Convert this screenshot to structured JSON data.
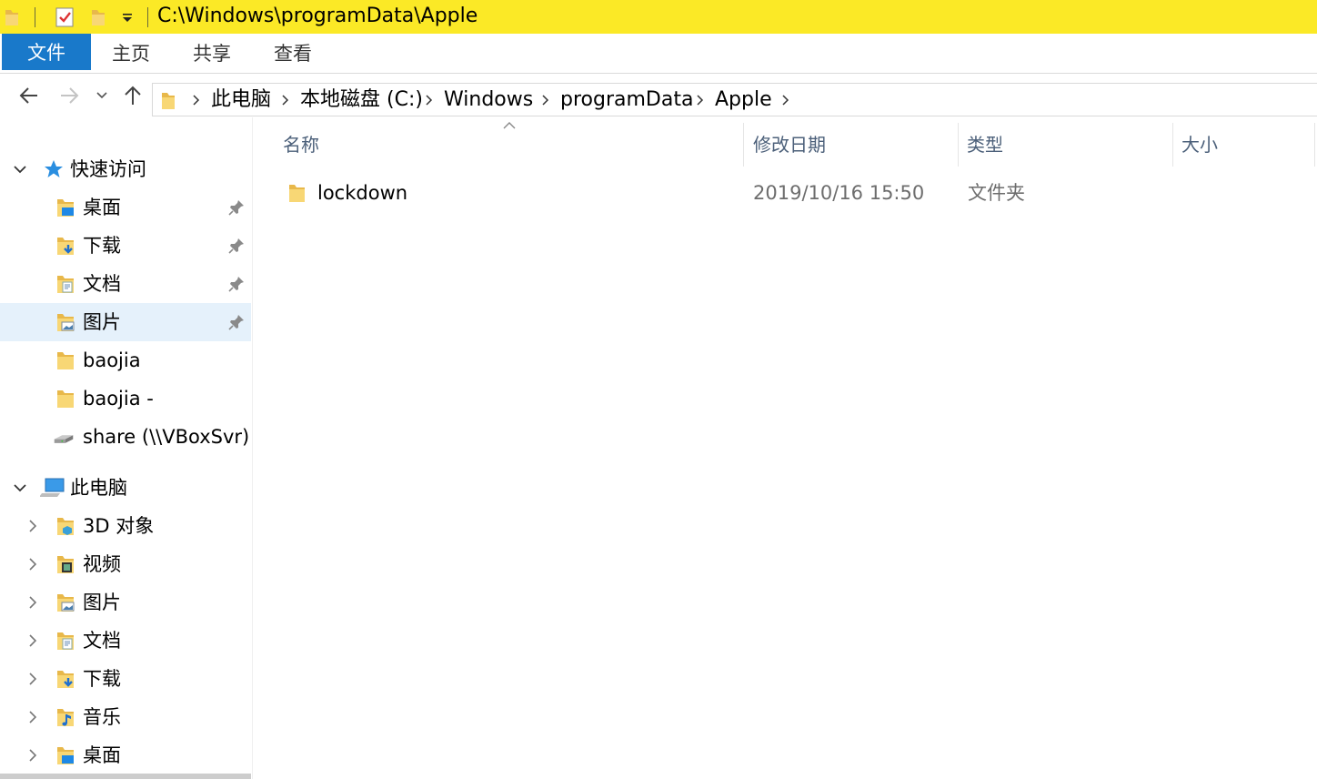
{
  "window": {
    "title_path": "C:\\Windows\\programData\\Apple"
  },
  "ribbon": {
    "tabs": [
      "文件",
      "主页",
      "共享",
      "查看"
    ]
  },
  "address": {
    "crumbs": [
      "此电脑",
      "本地磁盘 (C:)",
      "Windows",
      "programData",
      "Apple"
    ]
  },
  "sidebar": {
    "quick_access": {
      "label": "快速访问",
      "items": [
        {
          "label": "桌面",
          "icon": "desktop-folder-icon",
          "pinned": true
        },
        {
          "label": "下载",
          "icon": "downloads-folder-icon",
          "pinned": true
        },
        {
          "label": "文档",
          "icon": "documents-folder-icon",
          "pinned": true
        },
        {
          "label": "图片",
          "icon": "pictures-folder-icon",
          "pinned": true,
          "selected": true
        },
        {
          "label": "baojia",
          "icon": "folder-icon",
          "pinned": false
        },
        {
          "label": "baojia -",
          "icon": "folder-icon",
          "pinned": false
        },
        {
          "label": "share (\\\\VBoxSvr) (",
          "icon": "network-drive-icon",
          "pinned": false
        }
      ]
    },
    "this_pc": {
      "label": "此电脑",
      "items": [
        {
          "label": "3D 对象",
          "icon": "3d-objects-folder-icon"
        },
        {
          "label": "视频",
          "icon": "videos-folder-icon"
        },
        {
          "label": "图片",
          "icon": "pictures-folder-icon"
        },
        {
          "label": "文档",
          "icon": "documents-folder-icon"
        },
        {
          "label": "下载",
          "icon": "downloads-folder-icon"
        },
        {
          "label": "音乐",
          "icon": "music-folder-icon"
        },
        {
          "label": "桌面",
          "icon": "desktop-folder-icon"
        }
      ]
    }
  },
  "content": {
    "columns": {
      "name": "名称",
      "modified": "修改日期",
      "type": "类型",
      "size": "大小"
    },
    "files": [
      {
        "name": "lockdown",
        "modified": "2019/10/16 15:50",
        "type": "文件夹",
        "size": ""
      }
    ]
  },
  "colors": {
    "titlebar": "#fbe926",
    "file_tab": "#1979ca",
    "selected_row": "#e5f1fb",
    "folder": "#f8d775",
    "header_text": "#4c607a"
  }
}
